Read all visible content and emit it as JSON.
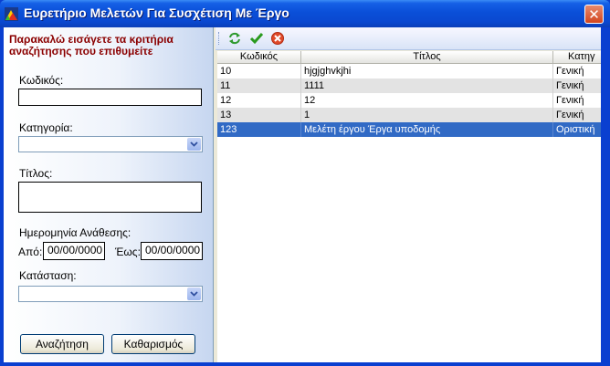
{
  "window": {
    "title": "Ευρετήριο Μελετών Για Συσχέτιση Με Έργο",
    "close_glyph": "✕"
  },
  "search": {
    "prompt": "Παρακαλώ εισάγετε τα κριτήρια αναζήτησης που επιθυμείτε",
    "code_label": "Κωδικός:",
    "code_value": "",
    "category_label": "Κατηγορία:",
    "category_value": "",
    "title_label": "Τίτλος:",
    "title_value": "",
    "date_label": "Ημερομηνία Ανάθεσης:",
    "from_label": "Από:",
    "from_value": "00/00/0000",
    "to_label": "Έως:",
    "to_value": "00/00/0000",
    "status_label": "Κατάσταση:",
    "status_value": "",
    "search_button": "Αναζήτηση",
    "clear_button": "Καθαρισμός"
  },
  "toolbar": {
    "icons": [
      "refresh-icon",
      "check-icon",
      "cancel-icon"
    ],
    "colors": {
      "refresh": "#2e9a2e",
      "check": "#2a9a1e",
      "cancel": "#e04a2a"
    }
  },
  "grid": {
    "columns": [
      "Κωδικός",
      "Τίτλος",
      "Κατηγ"
    ],
    "rows": [
      {
        "code": "10",
        "title": "hjgjghvkjhi",
        "category": "Γενική"
      },
      {
        "code": "11",
        "title": "1111",
        "category": "Γενική"
      },
      {
        "code": "12",
        "title": "12",
        "category": "Γενική"
      },
      {
        "code": "13",
        "title": "1",
        "category": "Γενική"
      },
      {
        "code": "123",
        "title": "Μελέτη έργου Έργα υποδομής",
        "category": "Οριστική"
      }
    ],
    "selected_row": 4,
    "selection_color": "#316ac5"
  },
  "colors": {
    "titlebar": "#0a4fd8",
    "prompt": "#8b0000"
  }
}
